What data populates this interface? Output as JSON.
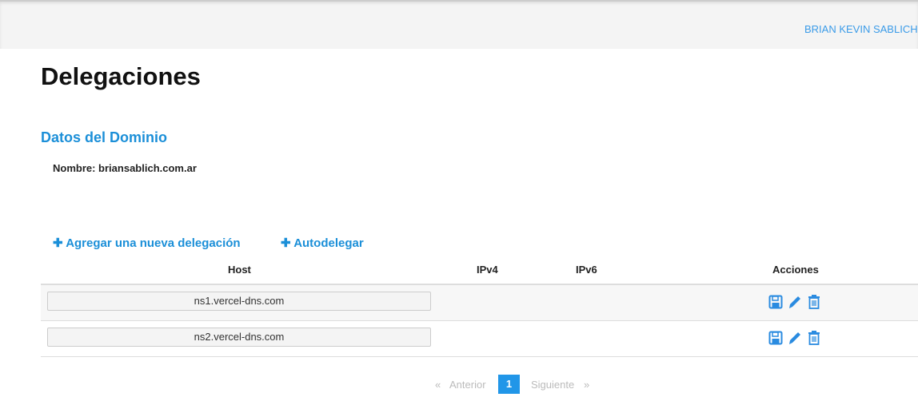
{
  "header": {
    "user": "BRIAN KEVIN SABLICH R"
  },
  "page": {
    "title": "Delegaciones",
    "section": "Datos del Dominio",
    "nombre": "Nombre: briansablich.com.ar"
  },
  "actions": {
    "add": "Agregar una nueva delegación",
    "auto": "Autodelegar"
  },
  "table": {
    "columns": [
      "Host",
      "IPv4",
      "IPv6",
      "Acciones"
    ],
    "rows": [
      {
        "host": "ns1.vercel-dns.com",
        "ipv4": "",
        "ipv6": ""
      },
      {
        "host": "ns2.vercel-dns.com",
        "ipv4": "",
        "ipv6": ""
      }
    ]
  },
  "pagination": {
    "prev_arrow": "«",
    "prev": "Anterior",
    "current": "1",
    "next": "Siguiente",
    "next_arrow": "»"
  },
  "colors": {
    "accent": "#1b8fd8",
    "icon": "#2a8be0"
  }
}
